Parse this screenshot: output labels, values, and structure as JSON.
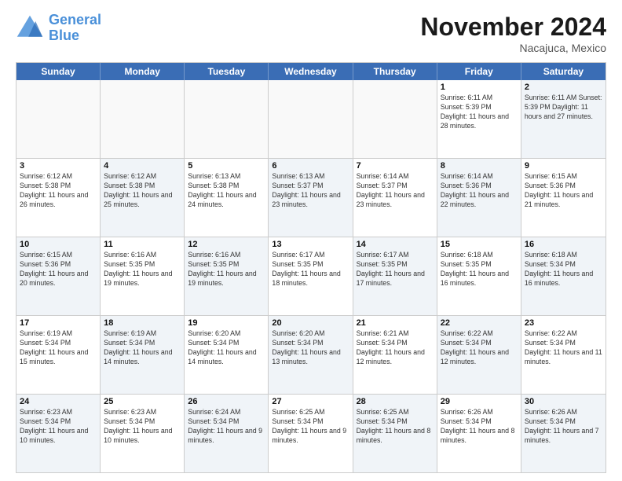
{
  "header": {
    "logo_line1": "General",
    "logo_line2": "Blue",
    "month_title": "November 2024",
    "location": "Nacajuca, Mexico"
  },
  "days_of_week": [
    "Sunday",
    "Monday",
    "Tuesday",
    "Wednesday",
    "Thursday",
    "Friday",
    "Saturday"
  ],
  "rows": [
    [
      {
        "day": "",
        "info": "",
        "empty": true
      },
      {
        "day": "",
        "info": "",
        "empty": true
      },
      {
        "day": "",
        "info": "",
        "empty": true
      },
      {
        "day": "",
        "info": "",
        "empty": true
      },
      {
        "day": "",
        "info": "",
        "empty": true
      },
      {
        "day": "1",
        "info": "Sunrise: 6:11 AM\nSunset: 5:39 PM\nDaylight: 11 hours\nand 28 minutes."
      },
      {
        "day": "2",
        "info": "Sunrise: 6:11 AM\nSunset: 5:39 PM\nDaylight: 11 hours\nand 27 minutes.",
        "alt": true
      }
    ],
    [
      {
        "day": "3",
        "info": "Sunrise: 6:12 AM\nSunset: 5:38 PM\nDaylight: 11 hours\nand 26 minutes."
      },
      {
        "day": "4",
        "info": "Sunrise: 6:12 AM\nSunset: 5:38 PM\nDaylight: 11 hours\nand 25 minutes.",
        "alt": true
      },
      {
        "day": "5",
        "info": "Sunrise: 6:13 AM\nSunset: 5:38 PM\nDaylight: 11 hours\nand 24 minutes."
      },
      {
        "day": "6",
        "info": "Sunrise: 6:13 AM\nSunset: 5:37 PM\nDaylight: 11 hours\nand 23 minutes.",
        "alt": true
      },
      {
        "day": "7",
        "info": "Sunrise: 6:14 AM\nSunset: 5:37 PM\nDaylight: 11 hours\nand 23 minutes."
      },
      {
        "day": "8",
        "info": "Sunrise: 6:14 AM\nSunset: 5:36 PM\nDaylight: 11 hours\nand 22 minutes.",
        "alt": true
      },
      {
        "day": "9",
        "info": "Sunrise: 6:15 AM\nSunset: 5:36 PM\nDaylight: 11 hours\nand 21 minutes."
      }
    ],
    [
      {
        "day": "10",
        "info": "Sunrise: 6:15 AM\nSunset: 5:36 PM\nDaylight: 11 hours\nand 20 minutes.",
        "alt": true
      },
      {
        "day": "11",
        "info": "Sunrise: 6:16 AM\nSunset: 5:35 PM\nDaylight: 11 hours\nand 19 minutes."
      },
      {
        "day": "12",
        "info": "Sunrise: 6:16 AM\nSunset: 5:35 PM\nDaylight: 11 hours\nand 19 minutes.",
        "alt": true
      },
      {
        "day": "13",
        "info": "Sunrise: 6:17 AM\nSunset: 5:35 PM\nDaylight: 11 hours\nand 18 minutes."
      },
      {
        "day": "14",
        "info": "Sunrise: 6:17 AM\nSunset: 5:35 PM\nDaylight: 11 hours\nand 17 minutes.",
        "alt": true
      },
      {
        "day": "15",
        "info": "Sunrise: 6:18 AM\nSunset: 5:35 PM\nDaylight: 11 hours\nand 16 minutes."
      },
      {
        "day": "16",
        "info": "Sunrise: 6:18 AM\nSunset: 5:34 PM\nDaylight: 11 hours\nand 16 minutes.",
        "alt": true
      }
    ],
    [
      {
        "day": "17",
        "info": "Sunrise: 6:19 AM\nSunset: 5:34 PM\nDaylight: 11 hours\nand 15 minutes."
      },
      {
        "day": "18",
        "info": "Sunrise: 6:19 AM\nSunset: 5:34 PM\nDaylight: 11 hours\nand 14 minutes.",
        "alt": true
      },
      {
        "day": "19",
        "info": "Sunrise: 6:20 AM\nSunset: 5:34 PM\nDaylight: 11 hours\nand 14 minutes."
      },
      {
        "day": "20",
        "info": "Sunrise: 6:20 AM\nSunset: 5:34 PM\nDaylight: 11 hours\nand 13 minutes.",
        "alt": true
      },
      {
        "day": "21",
        "info": "Sunrise: 6:21 AM\nSunset: 5:34 PM\nDaylight: 11 hours\nand 12 minutes."
      },
      {
        "day": "22",
        "info": "Sunrise: 6:22 AM\nSunset: 5:34 PM\nDaylight: 11 hours\nand 12 minutes.",
        "alt": true
      },
      {
        "day": "23",
        "info": "Sunrise: 6:22 AM\nSunset: 5:34 PM\nDaylight: 11 hours\nand 11 minutes."
      }
    ],
    [
      {
        "day": "24",
        "info": "Sunrise: 6:23 AM\nSunset: 5:34 PM\nDaylight: 11 hours\nand 10 minutes.",
        "alt": true
      },
      {
        "day": "25",
        "info": "Sunrise: 6:23 AM\nSunset: 5:34 PM\nDaylight: 11 hours\nand 10 minutes."
      },
      {
        "day": "26",
        "info": "Sunrise: 6:24 AM\nSunset: 5:34 PM\nDaylight: 11 hours\nand 9 minutes.",
        "alt": true
      },
      {
        "day": "27",
        "info": "Sunrise: 6:25 AM\nSunset: 5:34 PM\nDaylight: 11 hours\nand 9 minutes."
      },
      {
        "day": "28",
        "info": "Sunrise: 6:25 AM\nSunset: 5:34 PM\nDaylight: 11 hours\nand 8 minutes.",
        "alt": true
      },
      {
        "day": "29",
        "info": "Sunrise: 6:26 AM\nSunset: 5:34 PM\nDaylight: 11 hours\nand 8 minutes."
      },
      {
        "day": "30",
        "info": "Sunrise: 6:26 AM\nSunset: 5:34 PM\nDaylight: 11 hours\nand 7 minutes.",
        "alt": true
      }
    ]
  ]
}
